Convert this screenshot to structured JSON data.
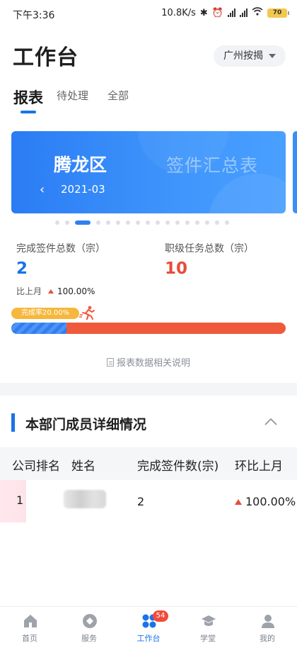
{
  "status_bar": {
    "time": "下午3:36",
    "net_speed": "10.8K/s",
    "battery": "70"
  },
  "header": {
    "title": "工作台",
    "city": "广州按揭"
  },
  "tabs": [
    {
      "label": "报表",
      "active": true
    },
    {
      "label": "待处理",
      "active": false
    },
    {
      "label": "全部",
      "active": false
    }
  ],
  "banner": {
    "district": "腾龙区",
    "report_title": "签件汇总表",
    "month": "2021-03",
    "prev_icon": "chevron-left-icon"
  },
  "carousel": {
    "total_dots": 17,
    "active_index": 2
  },
  "stats": {
    "completed": {
      "label": "完成签件总数（宗）",
      "value": "2",
      "color": "#1a73e8"
    },
    "task": {
      "label": "职级任务总数（宗）",
      "value": "10",
      "color": "#e74c3c"
    },
    "compare_label": "比上月",
    "compare_value": "100.00%"
  },
  "progress": {
    "badge": "完成率20.00%",
    "fraction": 0.2
  },
  "explain_link": "报表数据相关说明",
  "section": {
    "title": "本部门成员详细情况"
  },
  "table": {
    "headers": [
      "公司排名",
      "姓名",
      "完成签件数(宗)",
      "环比上月"
    ],
    "rows": [
      {
        "rank": "1",
        "count": "2",
        "ratio": "100.00%"
      }
    ]
  },
  "bottom_nav": [
    {
      "label": "首页",
      "icon": "home-icon"
    },
    {
      "label": "服务",
      "icon": "service-icon"
    },
    {
      "label": "工作台",
      "icon": "workbench-icon",
      "badge": "54",
      "active": true
    },
    {
      "label": "学堂",
      "icon": "graduation-cap-icon"
    },
    {
      "label": "我的",
      "icon": "user-icon"
    }
  ]
}
